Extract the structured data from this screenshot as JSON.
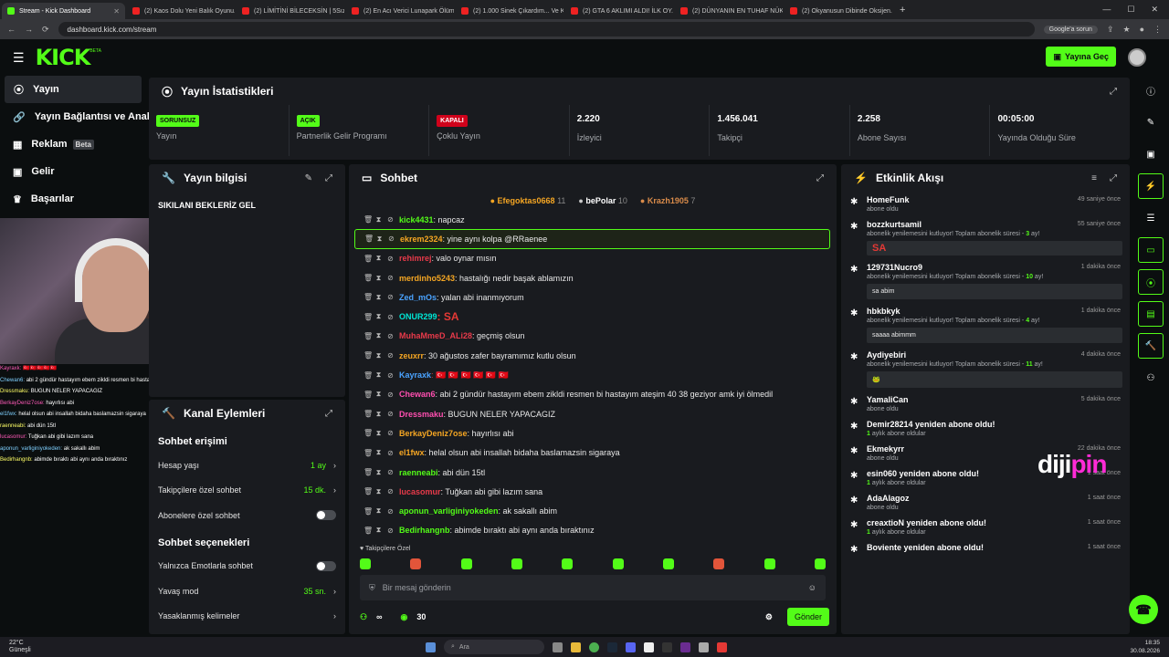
{
  "browser": {
    "tabs": [
      {
        "title": "Stream - Kick Dashboard",
        "active": true
      },
      {
        "title": "(2) Kaos Dolu Yeni Balık Oyunu..."
      },
      {
        "title": "(2) LİMİTİNİ BİLECEKSİN | 5Sızlı..."
      },
      {
        "title": "(2) En Acı Verici Lunapark Ölüm..."
      },
      {
        "title": "(2) 1.000 Sinek Çıkardım... Ve Ki..."
      },
      {
        "title": "(2) GTA 6 AKLIMI ALDI! İLK OY..."
      },
      {
        "title": "(2) DÜNYANIN EN TUHAF NÜK..."
      },
      {
        "title": "(2) Okyanusun Dibinde Oksijen..."
      }
    ],
    "url": "dashboard.kick.com/stream",
    "google_issue": "Google'a sorun"
  },
  "header": {
    "logo": "KICK",
    "logo_beta": "BETA",
    "go_live": "Yayına Geç"
  },
  "sidebar": {
    "items": [
      {
        "label": "Yayın",
        "icon": "broadcast-icon"
      },
      {
        "label": "Yayın Bağlantısı ve Anahtarı",
        "icon": "key-icon"
      },
      {
        "label": "Reklam",
        "badge": "Beta",
        "icon": "ad-icon"
      },
      {
        "label": "Gelir",
        "icon": "revenue-icon"
      },
      {
        "label": "Başarılar",
        "icon": "trophy-icon"
      }
    ]
  },
  "stream_chat_overlay": [
    {
      "user": "Kayraxk:",
      "text": "🇹🇷🇹🇷🇹🇷🇹🇷🇹🇷"
    },
    {
      "user": "Chewan6:",
      "text": "abi 2 gündür hastayım ebem zikldi resmen bi hastayım ateşim 40 38 geziyor amk iyi ölmedil"
    },
    {
      "user": "Dressmaku:",
      "text": "BUGUN NELER YAPACAGIZ"
    },
    {
      "user": "BerkayDeniz7ose:",
      "text": "hayırlısı abi"
    },
    {
      "user": "el1fwx:",
      "text": "helal olsun abi insallah bidaha baslamazsin sigaraya"
    },
    {
      "user": "raenneabi:",
      "text": "abi dün 15tl"
    },
    {
      "user": "lucasomur:",
      "text": "Tuğkan abi gibi lazım sana"
    },
    {
      "user": "aponun_varliginiyokeden:",
      "text": "ak sakallı abim"
    },
    {
      "user": "Bedirhangnb:",
      "text": "abimde bıraktı abi aynı anda bıraktınız"
    }
  ],
  "stats": {
    "title": "Yayın İstatistikleri",
    "items": [
      {
        "badge": "SORUNSUZ",
        "badge_color": "green",
        "label": "Yayın"
      },
      {
        "badge": "AÇIK",
        "badge_color": "green",
        "label": "Partnerlik Gelir Programı"
      },
      {
        "badge": "KAPALI",
        "badge_color": "red",
        "label": "Çoklu Yayın"
      },
      {
        "value": "2.220",
        "label": "İzleyici"
      },
      {
        "value": "1.456.041",
        "label": "Takipçi"
      },
      {
        "value": "2.258",
        "label": "Abone Sayısı"
      },
      {
        "value": "00:05:00",
        "label": "Yayında Olduğu Süre"
      }
    ]
  },
  "stream_info": {
    "title": "Yayın bilgisi",
    "stream_title": "SIKILANI BEKLERİZ GEL"
  },
  "channel_actions": {
    "title": "Kanal Eylemleri",
    "access_title": "Sohbet erişimi",
    "rows1": [
      {
        "label": "Hesap yaşı",
        "value": "1 ay"
      },
      {
        "label": "Takipçilere özel sohbet",
        "value": "15 dk."
      },
      {
        "label": "Abonelere özel sohbet",
        "toggle": false
      }
    ],
    "options_title": "Sohbet seçenekleri",
    "rows2": [
      {
        "label": "Yalnızca Emotlarla sohbet",
        "toggle": false
      },
      {
        "label": "Yavaş mod",
        "value": "35 sn."
      },
      {
        "label": "Yasaklanmış kelimeler"
      }
    ]
  },
  "chat": {
    "title": "Sohbet",
    "pinned": [
      {
        "name": "Efegoktas0668",
        "count": "11",
        "color": "#f5a623"
      },
      {
        "name": "bePolar",
        "count": "10",
        "color": "#cccccc"
      },
      {
        "name": "Krazh1905",
        "count": "7",
        "color": "#d98b4a"
      }
    ],
    "messages": [
      {
        "user": "kick4431",
        "color": "#53fc18",
        "text": ": napcaz"
      },
      {
        "user": "ekrem2324",
        "color": "#f5a623",
        "text": ": yine aynı kolpa @RRaenee",
        "highlight": true
      },
      {
        "user": "rehimrej",
        "color": "#e83a4a",
        "text": ": valo oynar mısın"
      },
      {
        "user": "merdinho5243",
        "color": "#f5a623",
        "text": ": hastalığı nedir başak ablamızın"
      },
      {
        "user": "Zed_mOs",
        "color": "#4aa3ff",
        "text": ": yalan abi inanmıyorum"
      },
      {
        "user": "ONUR299",
        "color": "#00e5d4",
        "text": ": SA"
      },
      {
        "user": "MuhaMmeD_ALi28",
        "color": "#e83a4a",
        "text": ": geçmiş olsun"
      },
      {
        "user": "zeuxrr",
        "color": "#f5a623",
        "text": ": 30 ağustos zafer bayramımız kutlu olsun"
      },
      {
        "user": "Kayraxk",
        "color": "#4aa3ff",
        "text": ": 🇹🇷 🇹🇷 🇹🇷 🇹🇷 🇹🇷 🇹🇷"
      },
      {
        "user": "Chewan6",
        "color": "#ff4fb0",
        "text": ": abi 2 gündür hastayım ebem zikldi resmen bi hastayım ateşim 40 38 geziyor amk iyi ölmedil"
      },
      {
        "user": "Dressmaku",
        "color": "#ff4fb0",
        "text": ": BUGUN NELER YAPACAGIZ"
      },
      {
        "user": "BerkayDeniz7ose",
        "color": "#f5a623",
        "text": ": hayırlısı abi"
      },
      {
        "user": "el1fwx",
        "color": "#f5a623",
        "text": ": helal olsun abi insallah bidaha baslamazsin sigaraya"
      },
      {
        "user": "raenneabi",
        "color": "#53fc18",
        "text": ": abi dün 15tl"
      },
      {
        "user": "lucasomur",
        "color": "#e83a4a",
        "text": ": Tuğkan abi gibi lazım sana"
      },
      {
        "user": "aponun_varliginiyokeden",
        "color": "#53fc18",
        "text": ": ak sakallı abim"
      },
      {
        "user": "Bedirhangnb",
        "color": "#53fc18",
        "text": ": abimde bıraktı abi aynı anda bıraktınız"
      }
    ],
    "followers_label": "Takipçilere Özel",
    "input_placeholder": "Bir mesaj gönderin",
    "infinity": "∞",
    "count": "30",
    "send": "Gönder"
  },
  "feed": {
    "title": "Etkinlik Akışı",
    "items": [
      {
        "name": "HomeFunk",
        "time": "49 saniye önce",
        "sub": "abone oldu"
      },
      {
        "name": "bozzkurtsamil",
        "time": "55 saniye önce",
        "sub": "abonelik yenilemesini kutluyor! Toplam abonelik süresi - ",
        "months": "3",
        "sub2": " ay!",
        "box": "SA"
      },
      {
        "name": "129731Nucro9",
        "time": "1 dakika önce",
        "sub": "abonelik yenilemesini kutluyor! Toplam abonelik süresi - ",
        "months": "10",
        "sub2": " ay!",
        "box": "sa abim"
      },
      {
        "name": "hbkbkyk",
        "time": "1 dakika önce",
        "sub": "abonelik yenilemesini kutluyor! Toplam abonelik süresi - ",
        "months": "4",
        "sub2": " ay!",
        "box": "saaaa abimmm"
      },
      {
        "name": "Aydiyebiri",
        "time": "4 dakika önce",
        "sub": "abonelik yenilemesini kutluyor! Toplam abonelik süresi - ",
        "months": "11",
        "sub2": " ay!",
        "box": "🐸"
      },
      {
        "name": "YamaliCan",
        "time": "5 dakika önce",
        "sub": "abone oldu"
      },
      {
        "name": "Demir28214 yeniden abone oldu!",
        "time": "",
        "months": "1",
        "sub2": " aylık abone oldular"
      },
      {
        "name": "Ekmekyrr",
        "time": "22 dakika önce",
        "sub": "abone oldu"
      },
      {
        "name": "esin060 yeniden abone oldu!",
        "time": "1 saat önce",
        "months": "1",
        "sub2": " aylık abone oldular"
      },
      {
        "name": "AdaAlagoz",
        "time": "1 saat önce",
        "sub": "abone oldu"
      },
      {
        "name": "creaxtioN yeniden abone oldu!",
        "time": "1 saat önce",
        "months": "1",
        "sub2": " aylık abone oldular"
      },
      {
        "name": "Boviente yeniden abone oldu!",
        "time": "1 saat önce"
      }
    ]
  },
  "watermark": {
    "a": "diji",
    "b": "pin"
  },
  "taskbar": {
    "temp": "22°C",
    "weather": "Güneşli",
    "search": "Ara",
    "time": "18:35",
    "date": "30.08.2026"
  }
}
